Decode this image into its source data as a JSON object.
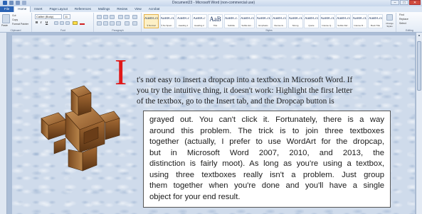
{
  "window": {
    "title": "Document23 - Microsoft Word (non-commercial use)",
    "controls": [
      "–",
      "□",
      "✕"
    ]
  },
  "ribbon": {
    "tabs": [
      {
        "label": "File",
        "kind": "file"
      },
      {
        "label": "Home",
        "kind": "active"
      },
      {
        "label": "Insert",
        "kind": ""
      },
      {
        "label": "Page Layout",
        "kind": ""
      },
      {
        "label": "References",
        "kind": ""
      },
      {
        "label": "Mailings",
        "kind": ""
      },
      {
        "label": "Review",
        "kind": ""
      },
      {
        "label": "View",
        "kind": ""
      },
      {
        "label": "Acrobat",
        "kind": ""
      }
    ],
    "clipboard": {
      "paste": "Paste",
      "cut": "Cut",
      "copy": "Copy",
      "format_painter": "Format Painter",
      "label": "Clipboard"
    },
    "font": {
      "name": "Calibri (Body)",
      "size": "11",
      "label": "Font",
      "bold": "B",
      "italic": "I",
      "underline": "U"
    },
    "paragraph": {
      "label": "Paragraph"
    },
    "styles": {
      "label": "Styles",
      "tiles": [
        {
          "sample": "AaBbCcDc",
          "name": "¶ Normal",
          "active": true,
          "big": false
        },
        {
          "sample": "AaBbCcDc",
          "name": "¶ No Spaci...",
          "active": false,
          "big": false
        },
        {
          "sample": "AaBbCc",
          "name": "Heading 1",
          "active": false,
          "big": false
        },
        {
          "sample": "AaBbCc",
          "name": "Heading 2",
          "active": false,
          "big": false
        },
        {
          "sample": "AaB",
          "name": "Title",
          "active": false,
          "big": true
        },
        {
          "sample": "AaBbCc.",
          "name": "Subtitle",
          "active": false,
          "big": false
        },
        {
          "sample": "AaBbCcDc",
          "name": "Subtle Em...",
          "active": false,
          "big": false
        },
        {
          "sample": "AaBbCcDc",
          "name": "Emphasis",
          "active": false,
          "big": false
        },
        {
          "sample": "AaBbCcDc",
          "name": "Intense E...",
          "active": false,
          "big": false
        },
        {
          "sample": "AaBbCcDc",
          "name": "Strong",
          "active": false,
          "big": false
        },
        {
          "sample": "AaBbCcDc",
          "name": "Quote",
          "active": false,
          "big": false
        },
        {
          "sample": "AaBbCcDc",
          "name": "Intense Q...",
          "active": false,
          "big": false
        },
        {
          "sample": "AaBbCcDc",
          "name": "Subtle Ref...",
          "active": false,
          "big": false
        },
        {
          "sample": "AaBbCcDc",
          "name": "Intense R...",
          "active": false,
          "big": false
        },
        {
          "sample": "AaBbCcDc",
          "name": "Book Title",
          "active": false,
          "big": false
        }
      ],
      "change_styles": "Change Styles"
    },
    "editing": {
      "find": "Find",
      "replace": "Replace",
      "select": "Select",
      "label": "Editing"
    }
  },
  "document": {
    "dropcap": "I",
    "lead_lines": [
      "t's not easy to insert a dropcap into a textbox in Microsoft Word. If",
      "you try the intuitive thing, it doesn't work: Highlight the first letter",
      "of the textbox, go to the Insert tab, and the Dropcap button is"
    ],
    "textbox_lines": [
      "grayed out. You can't click it. Fortunately, there is a way",
      "around this problem. The trick is to join three textboxes",
      "together (actually, I prefer to use WordArt for the dropcap,",
      "but in Microsoft Word 2007, 2010, and 2013, the",
      "distinction is fairly moot). As long as you're using a textbox,",
      "using three textboxes really isn't a problem. Just group",
      "them together when you're done and you'll have a single",
      "object for your end result."
    ],
    "image": "wooden-burr-puzzle",
    "colors": {
      "dropcap": "#e01818",
      "page_tint": "#cfdbeb",
      "wood_light": "#b8844a",
      "wood_dark": "#5a3414"
    }
  }
}
